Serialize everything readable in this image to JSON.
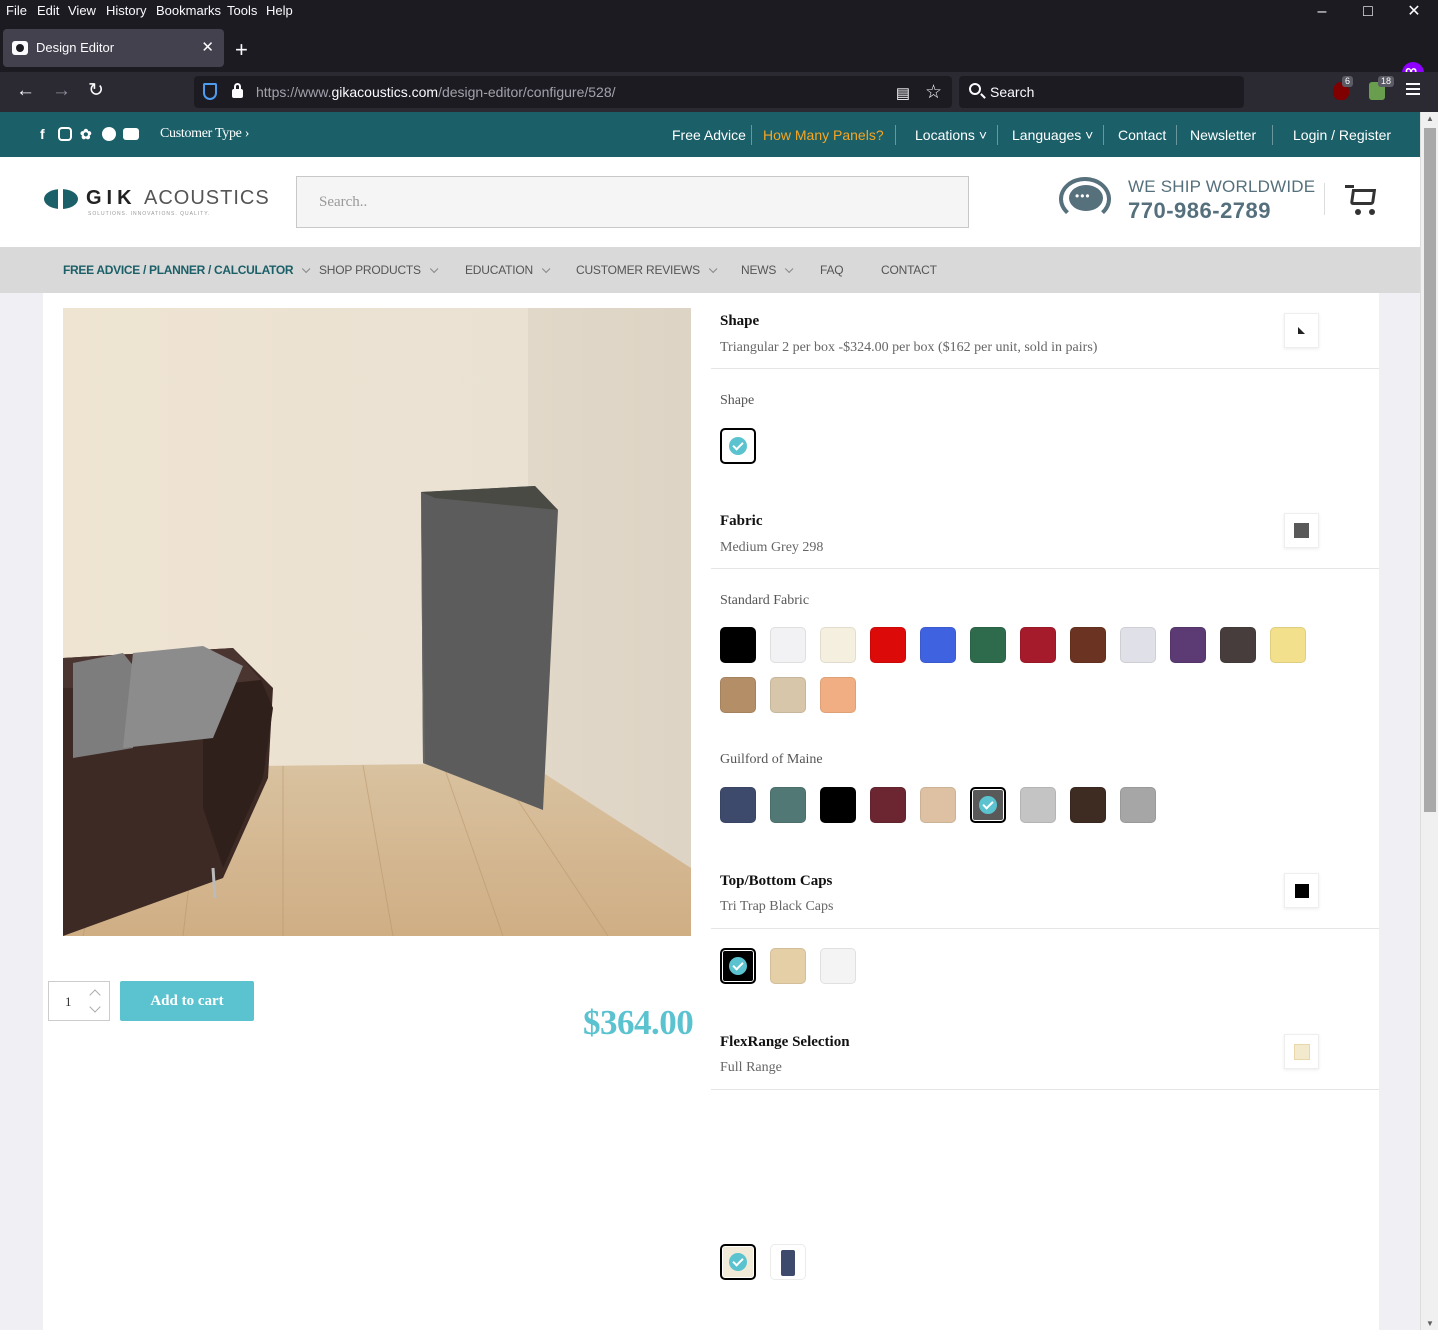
{
  "menubar": {
    "items": [
      "File",
      "Edit",
      "View",
      "History",
      "Bookmarks",
      "Tools",
      "Help"
    ]
  },
  "tab": {
    "title": "Design Editor"
  },
  "urlbar": {
    "url_prefix": "https://www.",
    "url_host": "gikacoustics.com",
    "url_path": "/design-editor/configure/528/"
  },
  "searchbar": {
    "placeholder": "Search"
  },
  "extensions": {
    "ublock_count": "6",
    "ext2_count": "18"
  },
  "topbar": {
    "customer_type": "Customer Type ›",
    "links": [
      "Free Advice",
      "How Many Panels?",
      "Locations",
      "Languages",
      "Contact",
      "Newsletter",
      "Login / Register"
    ]
  },
  "header": {
    "logo_gik": "GIK",
    "logo_acoustics": "ACOUSTICS",
    "logo_tagline": "SOLUTIONS. INNOVATIONS. QUALITY.",
    "search_placeholder": "Search..",
    "ship_text": "WE SHIP WORLDWIDE",
    "phone": "770-986-2789"
  },
  "mainnav": {
    "items": [
      "FREE ADVICE / PLANNER / CALCULATOR",
      "SHOP PRODUCTS",
      "EDUCATION",
      "CUSTOMER REVIEWS",
      "NEWS",
      "FAQ",
      "CONTACT"
    ]
  },
  "cart": {
    "quantity": "1",
    "add_label": "Add to cart",
    "price": "$364.00"
  },
  "options": {
    "shape": {
      "title": "Shape",
      "value": "Triangular 2 per box -$324.00 per box ($162 per unit, sold in pairs)",
      "group": "Shape"
    },
    "fabric": {
      "title": "Fabric",
      "value": "Medium Grey 298",
      "standard_label": "Standard Fabric",
      "standard_colors": [
        "#000000",
        "#f2f2f4",
        "#f5efe0",
        "#dd0a0a",
        "#3f63e0",
        "#2e6b4d",
        "#a61b2b",
        "#6b3321",
        "#e0e0e8",
        "#5c3a74",
        "#473d3d",
        "#f2e08c",
        "#b48e66",
        "#d7c6a9",
        "#f0ae82"
      ],
      "guilford_label": "Guilford of Maine",
      "guilford_colors": [
        "#3d4a6c",
        "#527875",
        "#000000",
        "#6b2632",
        "#ddc1a2",
        "#595959",
        "#c4c4c4",
        "#3e2b22",
        "#a6a6a6"
      ],
      "guilford_selected": 5
    },
    "caps": {
      "title": "Top/Bottom Caps",
      "value": "Tri Trap Black Caps",
      "colors": [
        "#000000",
        "#e4cfa6",
        "#f4f4f4"
      ],
      "selected": 0
    },
    "flexrange": {
      "title": "FlexRange Selection",
      "value": "Full Range"
    }
  }
}
